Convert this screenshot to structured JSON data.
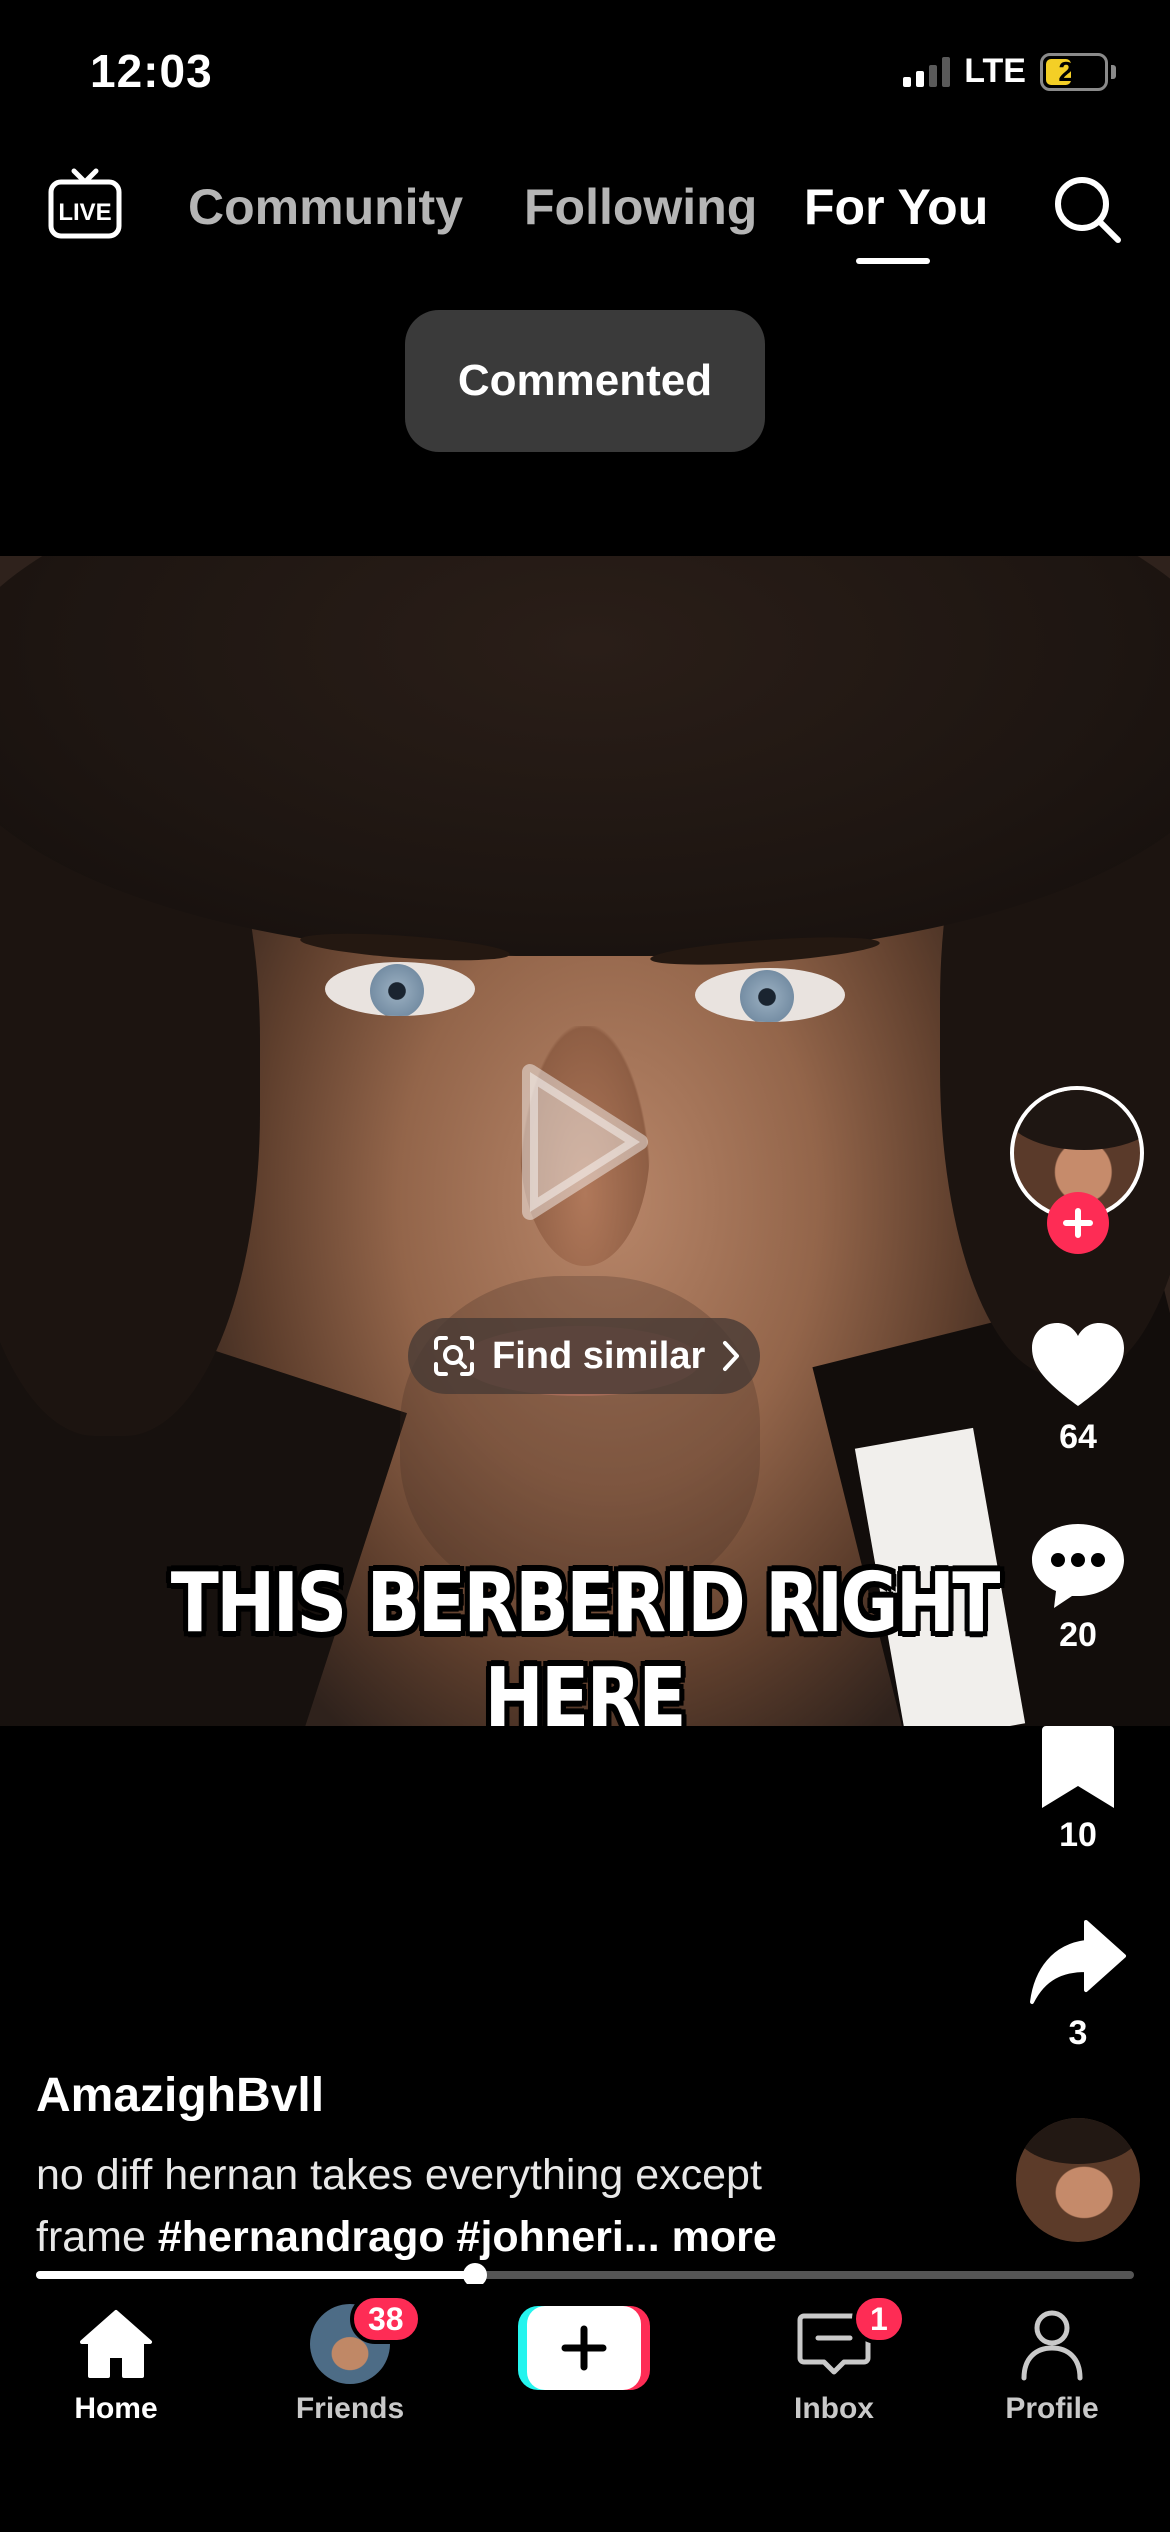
{
  "status_bar": {
    "time": "12:03",
    "network": "LTE",
    "battery": "25"
  },
  "top_nav": {
    "live_icon": "live-tv-icon",
    "tabs": [
      {
        "label": "Community",
        "active": false
      },
      {
        "label": "Following",
        "active": false
      },
      {
        "label": "For You",
        "active": true
      }
    ],
    "search_icon": "search-icon"
  },
  "toast": {
    "text": "Commented"
  },
  "video": {
    "state": "paused",
    "find_similar_label": "Find similar",
    "caption": "THIS BERBERID RIGHT HERE",
    "progress": 0.4
  },
  "actions": {
    "likes": "64",
    "comments": "20",
    "saves": "10",
    "shares": "3"
  },
  "post": {
    "username": "AmazighBvll",
    "description_line1": "no diff hernan takes everything except",
    "description_line2_prefix": "frame ",
    "description_tags": "#hernandrago #johneri...",
    "more_label": "more"
  },
  "bottom_nav": {
    "items": [
      {
        "label": "Home",
        "icon": "home-icon",
        "active": true
      },
      {
        "label": "Friends",
        "icon": "friends-avatar",
        "badge": "38"
      },
      {
        "label": "",
        "icon": "create-plus-icon"
      },
      {
        "label": "Inbox",
        "icon": "inbox-icon",
        "badge": "1"
      },
      {
        "label": "Profile",
        "icon": "profile-icon"
      }
    ]
  },
  "colors": {
    "accent": "#fe2c55",
    "secondary_accent": "#25f4ee",
    "background": "#000000",
    "battery": "#f4cf26"
  }
}
